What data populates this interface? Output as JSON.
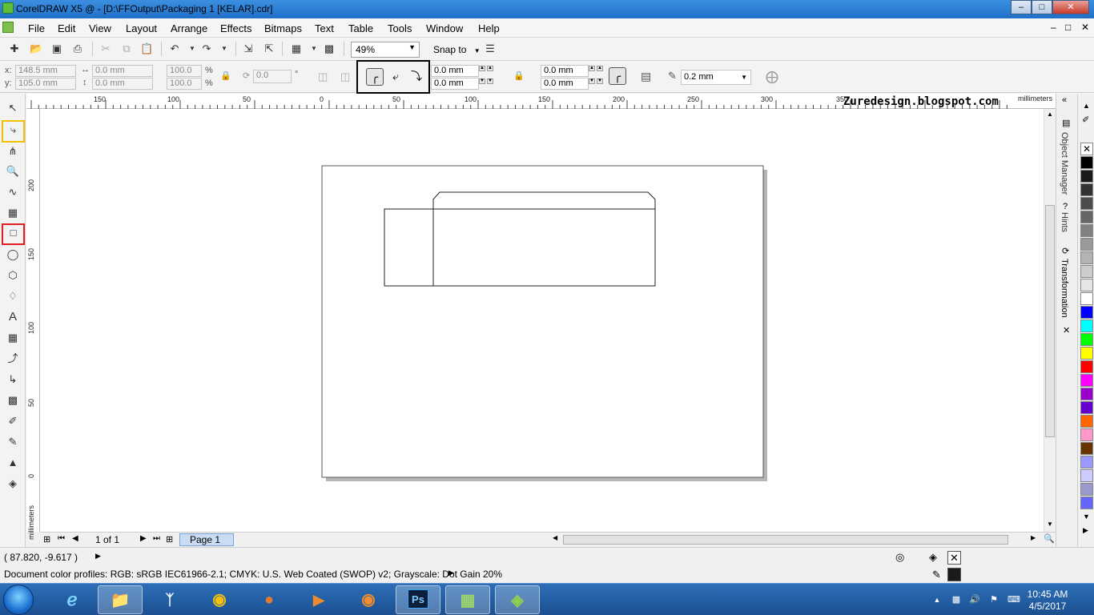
{
  "window": {
    "title": "CorelDRAW X5 @ - [D:\\FFOutput\\Packaging 1 [KELAR].cdr]",
    "minimize": "–",
    "maximize": "□",
    "close": "✕"
  },
  "menu": {
    "items": [
      "File",
      "Edit",
      "View",
      "Layout",
      "Arrange",
      "Effects",
      "Bitmaps",
      "Text",
      "Table",
      "Tools",
      "Window",
      "Help"
    ],
    "mdi_min": "–",
    "mdi_restore": "□",
    "mdi_close": "✕"
  },
  "toolbar": {
    "zoom": "49%",
    "snap_to": "Snap to"
  },
  "property_bar": {
    "x_label": "x:",
    "x_value": "148.5 mm",
    "y_label": "y:",
    "y_value": "105.0 mm",
    "w_value": "0.0 mm",
    "h_value": "0.0 mm",
    "scale_x": "100.0",
    "scale_y": "100.0",
    "percent": "%",
    "rotation": "0.0",
    "degree": "°",
    "corner_tl": "0.0 mm",
    "corner_bl": "0.0 mm",
    "corner_tr": "0.0 mm",
    "corner_br": "0.0 mm",
    "outline_width": "0.2 mm"
  },
  "ruler": {
    "unit": "millimeters",
    "h_labels": [
      "150",
      "100",
      "50",
      "0",
      "50",
      "100",
      "150",
      "200",
      "250",
      "300",
      "350"
    ],
    "v_labels": [
      "200",
      "150",
      "100",
      "50",
      "0"
    ],
    "v_unit": "millimeters"
  },
  "canvas": {
    "watermark": "Zuredesign.blogspot.com"
  },
  "pages": {
    "counter": "1 of 1",
    "tab": "Page 1"
  },
  "docker": {
    "tabs": [
      "Object Manager",
      "Hints",
      "Transformation"
    ]
  },
  "palette": {
    "colors": [
      "#000000",
      "#1a1a1a",
      "#333333",
      "#4d4d4d",
      "#666666",
      "#808080",
      "#999999",
      "#b3b3b3",
      "#cccccc",
      "#e6e6e6",
      "#ffffff",
      "#0000ff",
      "#00ffff",
      "#00ff00",
      "#ffff00",
      "#ff0000",
      "#ff00ff",
      "#9900cc",
      "#6600cc",
      "#ff6600",
      "#ff99cc",
      "#663300",
      "#9999ff",
      "#ccccff",
      "#9999cc",
      "#6666ff"
    ]
  },
  "status": {
    "coords": "( 87.820, -9.617 )",
    "profiles": "Document color profiles: RGB: sRGB IEC61966-2.1; CMYK: U.S. Web Coated (SWOP) v2; Grayscale: Dot Gain 20%"
  },
  "taskbar": {
    "apps": [
      "IE",
      "Explorer",
      "Bluetooth",
      "Chrome",
      "Game",
      "Media",
      "Firefox",
      "Ps",
      "Audio",
      "CorelDRAW"
    ],
    "time": "10:45 AM",
    "date": "4/5/2017"
  }
}
